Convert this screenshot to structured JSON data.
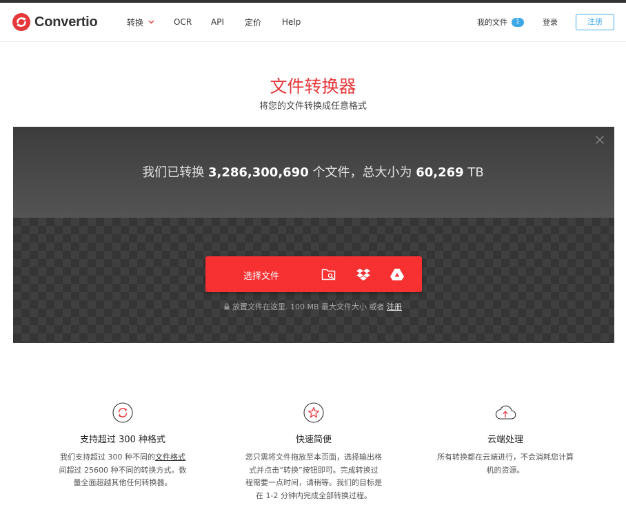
{
  "header": {
    "brand": "Convertio",
    "nav": {
      "convert": "转换",
      "ocr": "OCR",
      "api": "API",
      "pricing": "定价",
      "help": "Help"
    },
    "my_files": "我的文件",
    "my_files_count": "1",
    "login": "登录",
    "signup": "注册"
  },
  "hero": {
    "title": "文件转换器",
    "subtitle": "将您的文件转换成任意格式"
  },
  "stats": {
    "prefix": "我们已转换",
    "files_count": "3,286,300,690",
    "middle": "个文件，总大小为",
    "total_size": "60,269",
    "unit": "TB"
  },
  "upload": {
    "choose_label": "选择文件",
    "hint_text": "放置文件在这里. 100 MB 最大文件大小 或者",
    "hint_link": "注册"
  },
  "features": [
    {
      "icon": "refresh-icon",
      "title": "支持超过 300 种格式",
      "desc_before": "我们支持超过 300 种不同的",
      "desc_link": "文件格式",
      "desc_after": "间超过 25600 种不同的转换方式。数量全面超越其他任何转换器。"
    },
    {
      "icon": "star-icon",
      "title": "快速简便",
      "desc": "您只需将文件拖放至本页面，选择输出格式并点击“转换”按钮即可。完成转换过程需要一点时间，请稍等。我们的目标是在 1-2 分钟内完成全部转换过程。"
    },
    {
      "icon": "cloud-upload-icon",
      "title": "云端处理",
      "desc": "所有转换都在云端进行，不会消耗您计算机的资源。"
    }
  ],
  "colors": {
    "brand_red": "#e5383b",
    "button_red": "#f73032",
    "accent_blue": "#3fa8e8"
  }
}
